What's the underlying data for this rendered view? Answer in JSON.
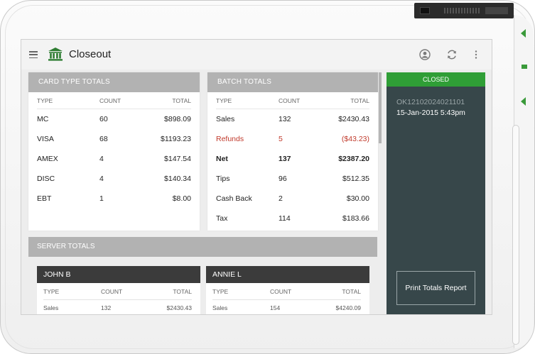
{
  "header": {
    "title": "Closeout",
    "icons": [
      "menu-icon",
      "bank-icon",
      "account-icon",
      "refresh-icon",
      "more-vert-icon"
    ]
  },
  "card_type_totals": {
    "title": "CARD TYPE TOTALS",
    "columns": [
      "TYPE",
      "COUNT",
      "TOTAL"
    ],
    "rows": [
      [
        "MC",
        "60",
        "$898.09"
      ],
      [
        "VISA",
        "68",
        "$1193.23"
      ],
      [
        "AMEX",
        "4",
        "$147.54"
      ],
      [
        "DISC",
        "4",
        "$140.34"
      ],
      [
        "EBT",
        "1",
        "$8.00"
      ]
    ]
  },
  "batch_totals": {
    "title": "BATCH TOTALS",
    "columns": [
      "TYPE",
      "COUNT",
      "TOTAL"
    ],
    "rows": [
      [
        "Sales",
        "132",
        "$2430.43"
      ],
      [
        "Refunds",
        "5",
        "($43.23)"
      ],
      [
        "Net",
        "137",
        "$2387.20"
      ],
      [
        "Tips",
        "96",
        "$512.35"
      ],
      [
        "Cash Back",
        "2",
        "$30.00"
      ],
      [
        "Tax",
        "114",
        "$183.66"
      ]
    ]
  },
  "status_panel": {
    "status": "CLOSED",
    "batch_id": "OK12102024021101",
    "date": "15-Jan-2015 5:43pm",
    "print_button": "Print Totals Report"
  },
  "server_totals": {
    "title": "SERVER TOTALS",
    "servers": [
      {
        "name": "JOHN B",
        "columns": [
          "TYPE",
          "COUNT",
          "TOTAL"
        ],
        "rows": [
          [
            "Sales",
            "132",
            "$2430.43"
          ]
        ]
      },
      {
        "name": "ANNIE L",
        "columns": [
          "TYPE",
          "COUNT",
          "TOTAL"
        ],
        "rows": [
          [
            "Sales",
            "154",
            "$4240.09"
          ]
        ]
      }
    ]
  },
  "colors": {
    "accent_green": "#2f9e36",
    "panel_dark": "#37474a",
    "refund_red": "#c0392b",
    "header_gray": "#b2b2b2"
  }
}
